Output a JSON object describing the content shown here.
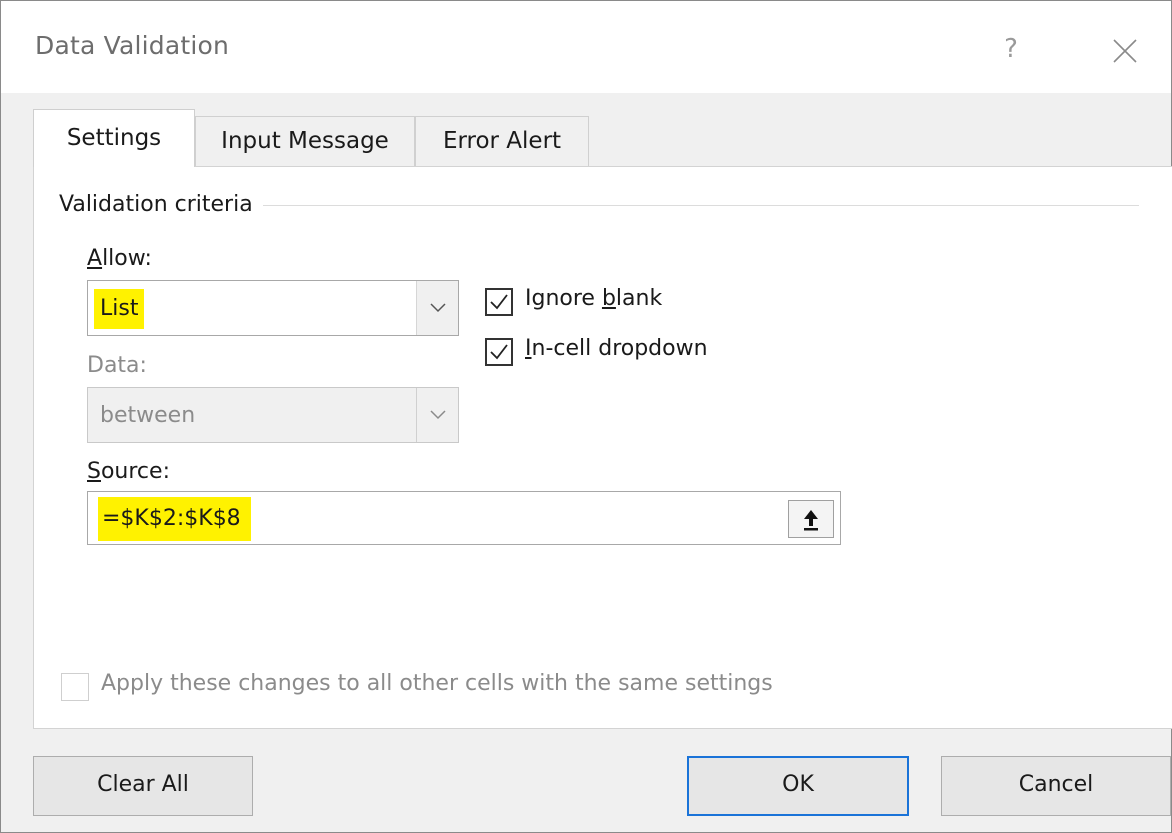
{
  "window": {
    "title": "Data Validation",
    "help_label": "?",
    "close_icon": "close-icon"
  },
  "tabs": [
    {
      "label": "Settings",
      "active": true
    },
    {
      "label": "Input Message",
      "active": false
    },
    {
      "label": "Error Alert",
      "active": false
    }
  ],
  "criteria": {
    "group_label": "Validation criteria",
    "allow_label": "Allow:",
    "allow_value": "List",
    "data_label": "Data:",
    "data_value": "between",
    "source_label": "Source:",
    "source_value": "=$K$2:$K$8",
    "ignore_blank": {
      "label_prefix": "Ignore ",
      "label_accel": "b",
      "label_suffix": "lank",
      "checked": true
    },
    "incell_dropdown": {
      "label_accel": "I",
      "label_suffix": "n-cell dropdown",
      "checked": true
    },
    "apply_all": {
      "label": "Apply these changes to all other cells with the same settings",
      "checked": false,
      "enabled": false
    }
  },
  "buttons": {
    "clear_all": "Clear All",
    "ok": "OK",
    "cancel": "Cancel"
  },
  "colors": {
    "highlight": "#fff200",
    "default_button_border": "#1a73d8"
  }
}
